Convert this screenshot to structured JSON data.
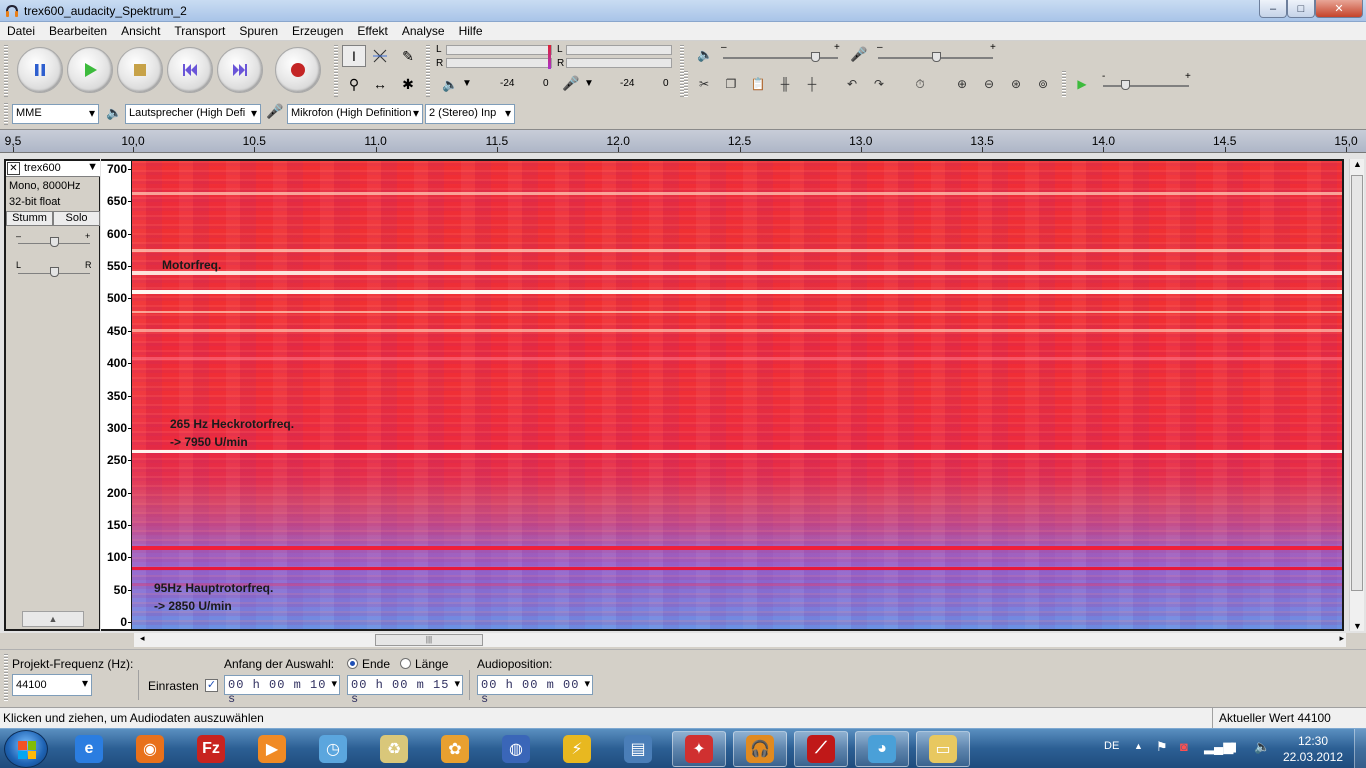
{
  "window": {
    "title": "trex600_audacity_Spektrum_2",
    "controls": {
      "minimize": "–",
      "maximize": "□",
      "close": "✕"
    }
  },
  "menu": [
    "Datei",
    "Bearbeiten",
    "Ansicht",
    "Transport",
    "Spuren",
    "Erzeugen",
    "Effekt",
    "Analyse",
    "Hilfe"
  ],
  "transport": {
    "buttons": [
      "pause-icon",
      "play-icon",
      "stop-icon",
      "skip-start-icon",
      "skip-end-icon",
      "record-icon"
    ]
  },
  "tools": {
    "selection": "I",
    "envelope": "envelope-icon",
    "draw": "✎",
    "zoom": "⚲",
    "timeshift": "↔",
    "multi": "✱"
  },
  "meters": {
    "play_channel_left": "L",
    "play_channel_right": "R",
    "rec_channel_left": "L",
    "rec_channel_right": "R",
    "scale_a": "-24",
    "scale_b": "0",
    "scale_c": "-24",
    "scale_d": "0"
  },
  "mixer": {
    "output_minus": "–",
    "output_plus": "+",
    "input_minus": "–",
    "input_plus": "+",
    "output_level": 0.8,
    "input_level": 0.5
  },
  "edit_tools": [
    "cut-icon",
    "copy-icon",
    "paste-icon",
    "trim-icon",
    "silence-icon",
    "undo-icon",
    "redo-icon",
    "sync-icon",
    "zoom-in-icon",
    "zoom-out-icon",
    "fit-selection-icon",
    "fit-project-icon",
    "play-at-speed-icon"
  ],
  "play_speed": {
    "minus": "-",
    "plus": "+",
    "level": 0.25
  },
  "devices": {
    "host": "MME",
    "output": "Lautsprecher (High Defi",
    "input": "Mikrofon (High Definition",
    "channels": "2 (Stereo) Inp"
  },
  "ruler": {
    "ticks": [
      "9,5",
      "10,0",
      "10.5",
      "11.0",
      "11.5",
      "12.0",
      "12.5",
      "13.0",
      "13.5",
      "14.0",
      "14.5",
      "15,0"
    ]
  },
  "track": {
    "name": "trex600",
    "close": "✕",
    "dropdown": "▼",
    "format_line1": "Mono, 8000Hz",
    "format_line2": "32-bit float",
    "mute": "Stumm",
    "solo": "Solo",
    "gain_minus": "–",
    "gain_plus": "+",
    "gain_level": 0.5,
    "pan_left": "L",
    "pan_right": "R",
    "pan_level": 0.5,
    "collapse": "▲"
  },
  "freq_scale": [
    "700",
    "650",
    "600",
    "550",
    "500",
    "450",
    "400",
    "350",
    "300",
    "250",
    "200",
    "150",
    "100",
    "50",
    "0"
  ],
  "annotations": {
    "motor": "Motorfreq.",
    "tail_line1": "265 Hz Heckrotorfreq.",
    "tail_line2": "-> 7950 U/min",
    "main_line1": "95Hz Hauptrotorfreq.",
    "main_line2": "-> 2850 U/min"
  },
  "selection_toolbar": {
    "project_rate_label": "Projekt-Frequenz (Hz):",
    "project_rate": "44100",
    "snap_label": "Einrasten",
    "snap_checked": true,
    "start_label": "Anfang der Auswahl:",
    "end_label": "Ende",
    "length_label": "Länge",
    "end_selected": true,
    "start_value": "00 h 00 m 10 s",
    "end_value": "00 h 00 m 15 s",
    "audio_position_label": "Audioposition:",
    "audio_position": "00 h 00 m 00 s"
  },
  "status": {
    "hint": "Klicken und ziehen, um Audiodaten auszuwählen",
    "value": "Aktueller Wert 44100"
  },
  "taskbar": {
    "apps": [
      {
        "name": "internet-explorer-icon",
        "label": "e",
        "color": "#2b7de0"
      },
      {
        "name": "firefox-icon",
        "label": "◉",
        "color": "#e8711c"
      },
      {
        "name": "filezilla-icon",
        "label": "Fz",
        "color": "#c8231f"
      },
      {
        "name": "media-player-icon",
        "label": "▶",
        "color": "#f08a24"
      },
      {
        "name": "clock-icon",
        "label": "◷",
        "color": "#5ba6de"
      },
      {
        "name": "recycle-icon",
        "label": "♻",
        "color": "#d9c77a"
      },
      {
        "name": "lotus-icon",
        "label": "✿",
        "color": "#e8a030"
      },
      {
        "name": "google-earth-icon",
        "label": "◍",
        "color": "#3a66b8"
      },
      {
        "name": "tools-icon",
        "label": "⚡",
        "color": "#e8b820"
      },
      {
        "name": "window-app-icon",
        "label": "▤",
        "color": "#4a7eb8"
      },
      {
        "name": "flame-app-icon",
        "label": "✦",
        "color": "#d03030"
      },
      {
        "name": "audacity-icon",
        "label": "🎧",
        "color": "#e08a20"
      },
      {
        "name": "red-app-icon",
        "label": "⟋",
        "color": "#c01818"
      },
      {
        "name": "paint-icon",
        "label": "◕",
        "color": "#4aa0d8"
      },
      {
        "name": "explorer-icon",
        "label": "▭",
        "color": "#e8c860"
      }
    ],
    "open_apps": [
      "flame-app-icon",
      "audacity-icon",
      "red-app-icon",
      "paint-icon",
      "explorer-icon"
    ],
    "language": "DE",
    "time": "12:30",
    "date": "22.03.2012"
  }
}
